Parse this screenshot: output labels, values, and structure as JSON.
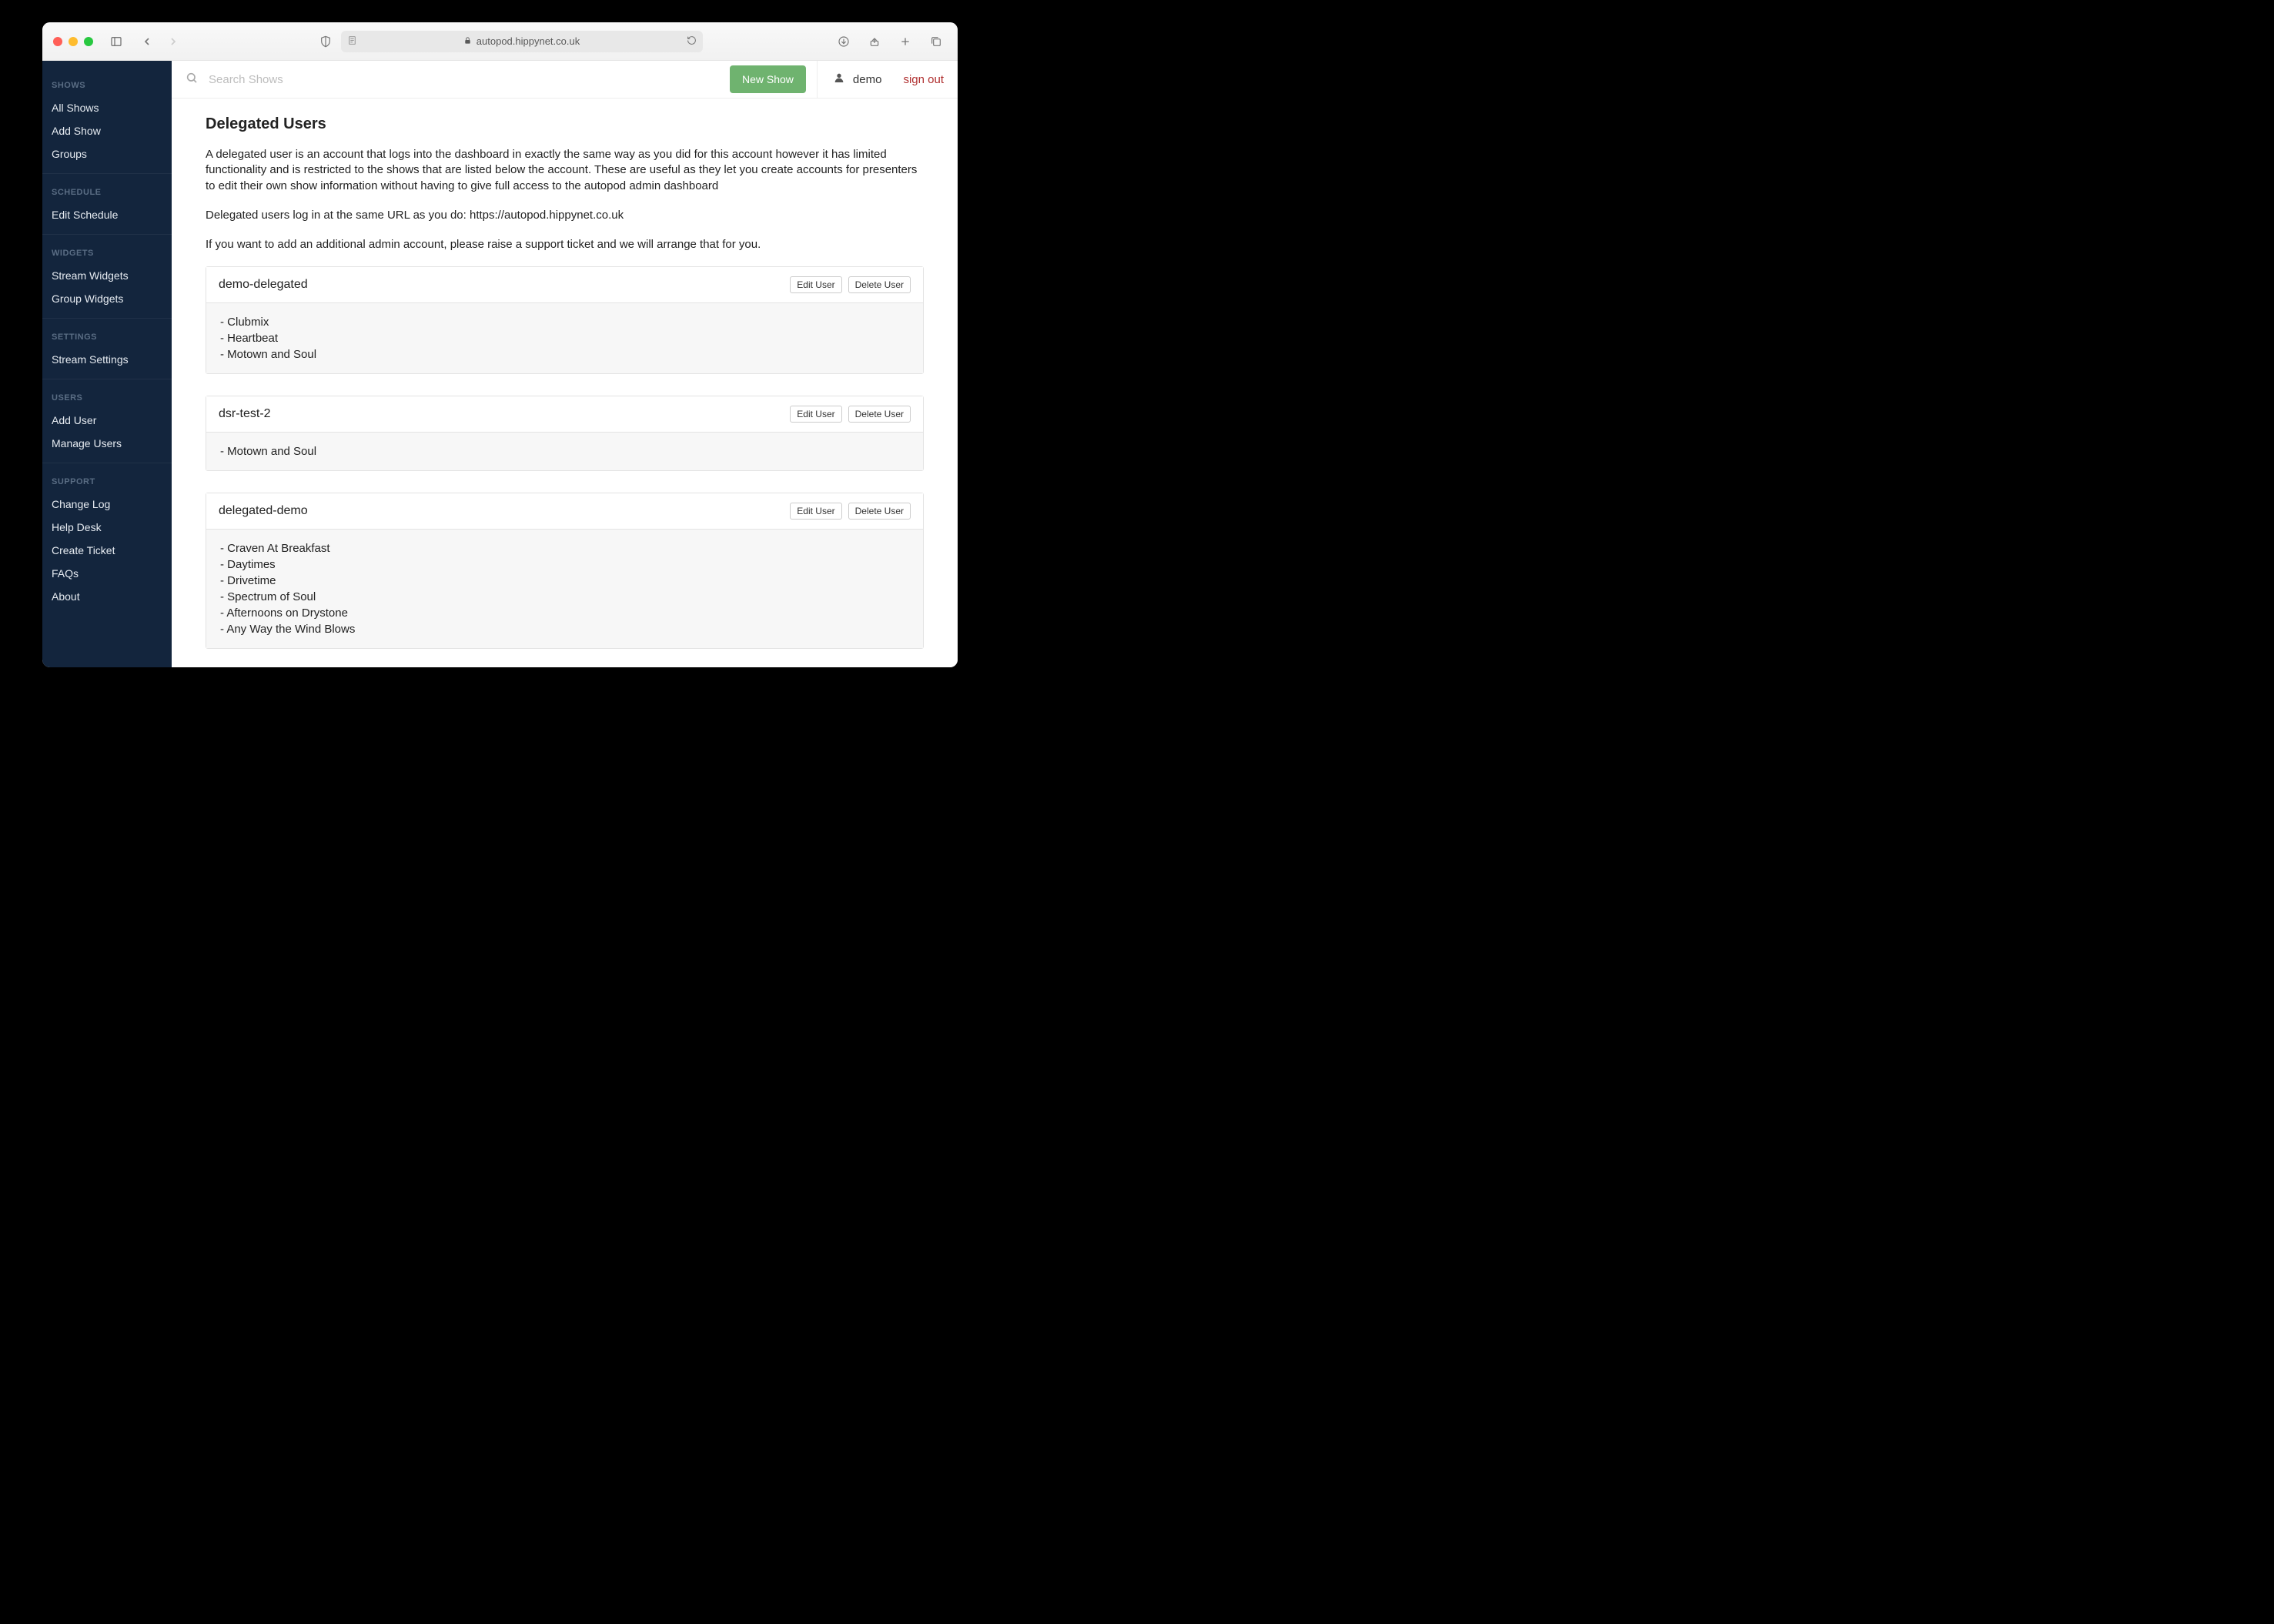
{
  "browser": {
    "url": "autopod.hippynet.co.uk"
  },
  "topbar": {
    "search_placeholder": "Search Shows",
    "new_show": "New Show",
    "username": "demo",
    "signout": "sign out"
  },
  "sidebar": {
    "sections": [
      {
        "label": "SHOWS",
        "items": [
          "All Shows",
          "Add Show",
          "Groups"
        ]
      },
      {
        "label": "SCHEDULE",
        "items": [
          "Edit Schedule"
        ]
      },
      {
        "label": "WIDGETS",
        "items": [
          "Stream Widgets",
          "Group Widgets"
        ]
      },
      {
        "label": "SETTINGS",
        "items": [
          "Stream Settings"
        ]
      },
      {
        "label": "USERS",
        "items": [
          "Add User",
          "Manage Users"
        ]
      },
      {
        "label": "SUPPORT",
        "items": [
          "Change Log",
          "Help Desk",
          "Create Ticket",
          "FAQs",
          "About"
        ]
      }
    ]
  },
  "page": {
    "title": "Delegated Users",
    "intro1": "A delegated user is an account that logs into the dashboard in exactly the same way as you did for this account however it has limited functionality and is restricted to the shows that are listed below the account. These are useful as they let you create accounts for presenters to edit their own show information without having to give full access to the autopod admin dashboard",
    "intro2": "Delegated users log in at the same URL as you do: https://autopod.hippynet.co.uk",
    "intro3": "If you want to add an additional admin account, please raise a support ticket and we will arrange that for you.",
    "edit_label": "Edit User",
    "delete_label": "Delete User",
    "users": [
      {
        "name": "demo-delegated",
        "shows": [
          "Clubmix",
          "Heartbeat",
          "Motown and Soul"
        ]
      },
      {
        "name": "dsr-test-2",
        "shows": [
          "Motown and Soul"
        ]
      },
      {
        "name": "delegated-demo",
        "shows": [
          "Craven At Breakfast",
          "Daytimes",
          "Drivetime",
          "Spectrum of Soul",
          "Afternoons on Drystone",
          "Any Way the Wind Blows"
        ]
      }
    ]
  }
}
